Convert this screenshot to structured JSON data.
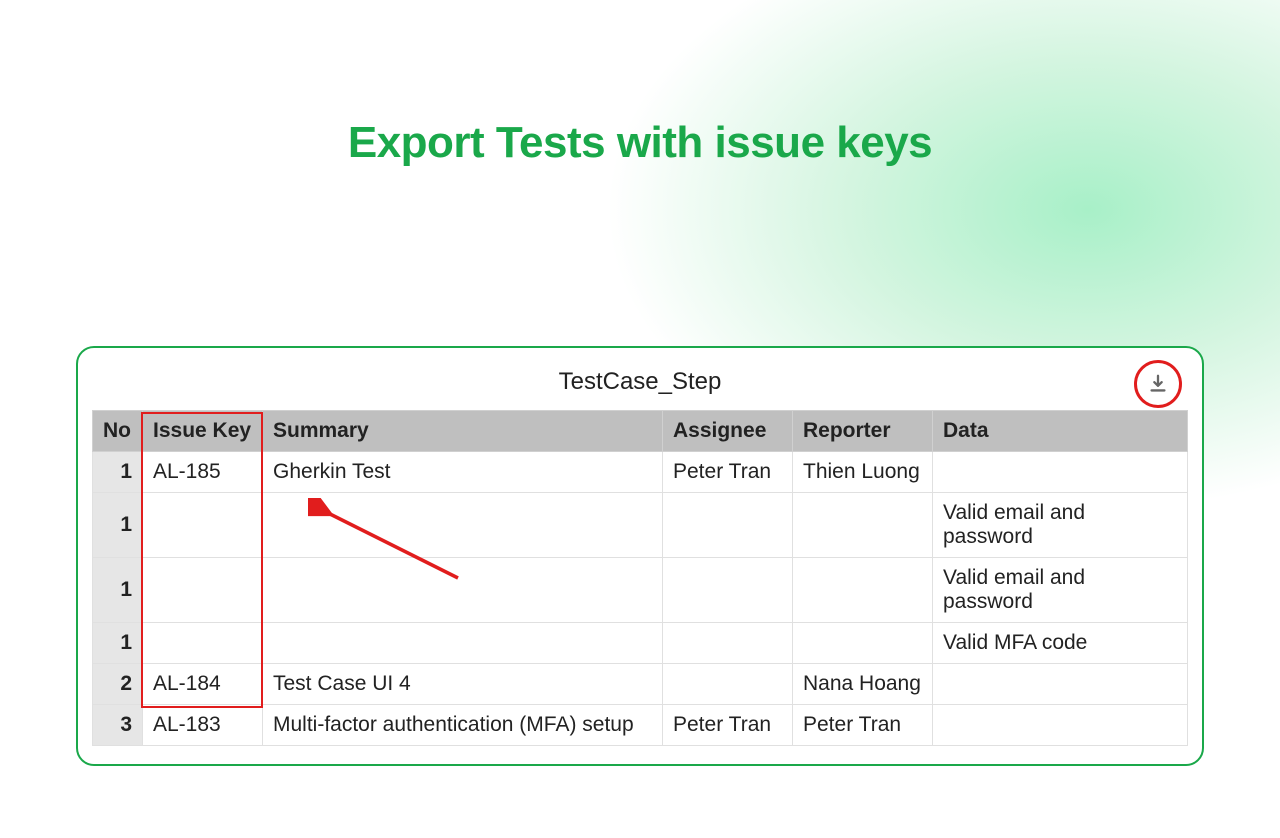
{
  "title": "Export Tests with issue keys",
  "panel_title": "TestCase_Step",
  "columns": {
    "no": "No",
    "issue_key": "Issue Key",
    "summary": "Summary",
    "assignee": "Assignee",
    "reporter": "Reporter",
    "data": "Data"
  },
  "rows": [
    {
      "no": "1",
      "issue_key": "AL-185",
      "summary": "Gherkin Test",
      "assignee": "Peter Tran",
      "reporter": "Thien Luong",
      "data": ""
    },
    {
      "no": "1",
      "issue_key": "",
      "summary": "",
      "assignee": "",
      "reporter": "",
      "data": "Valid email and password"
    },
    {
      "no": "1",
      "issue_key": "",
      "summary": "",
      "assignee": "",
      "reporter": "",
      "data": "Valid email and password"
    },
    {
      "no": "1",
      "issue_key": "",
      "summary": "",
      "assignee": "",
      "reporter": "",
      "data": "Valid MFA code"
    },
    {
      "no": "2",
      "issue_key": "AL-184",
      "summary": "Test Case UI 4",
      "assignee": "",
      "reporter": "Nana Hoang",
      "data": ""
    },
    {
      "no": "3",
      "issue_key": "AL-183",
      "summary": "Multi-factor authentication (MFA) setup",
      "assignee": "Peter Tran",
      "reporter": "Peter Tran",
      "data": ""
    }
  ]
}
